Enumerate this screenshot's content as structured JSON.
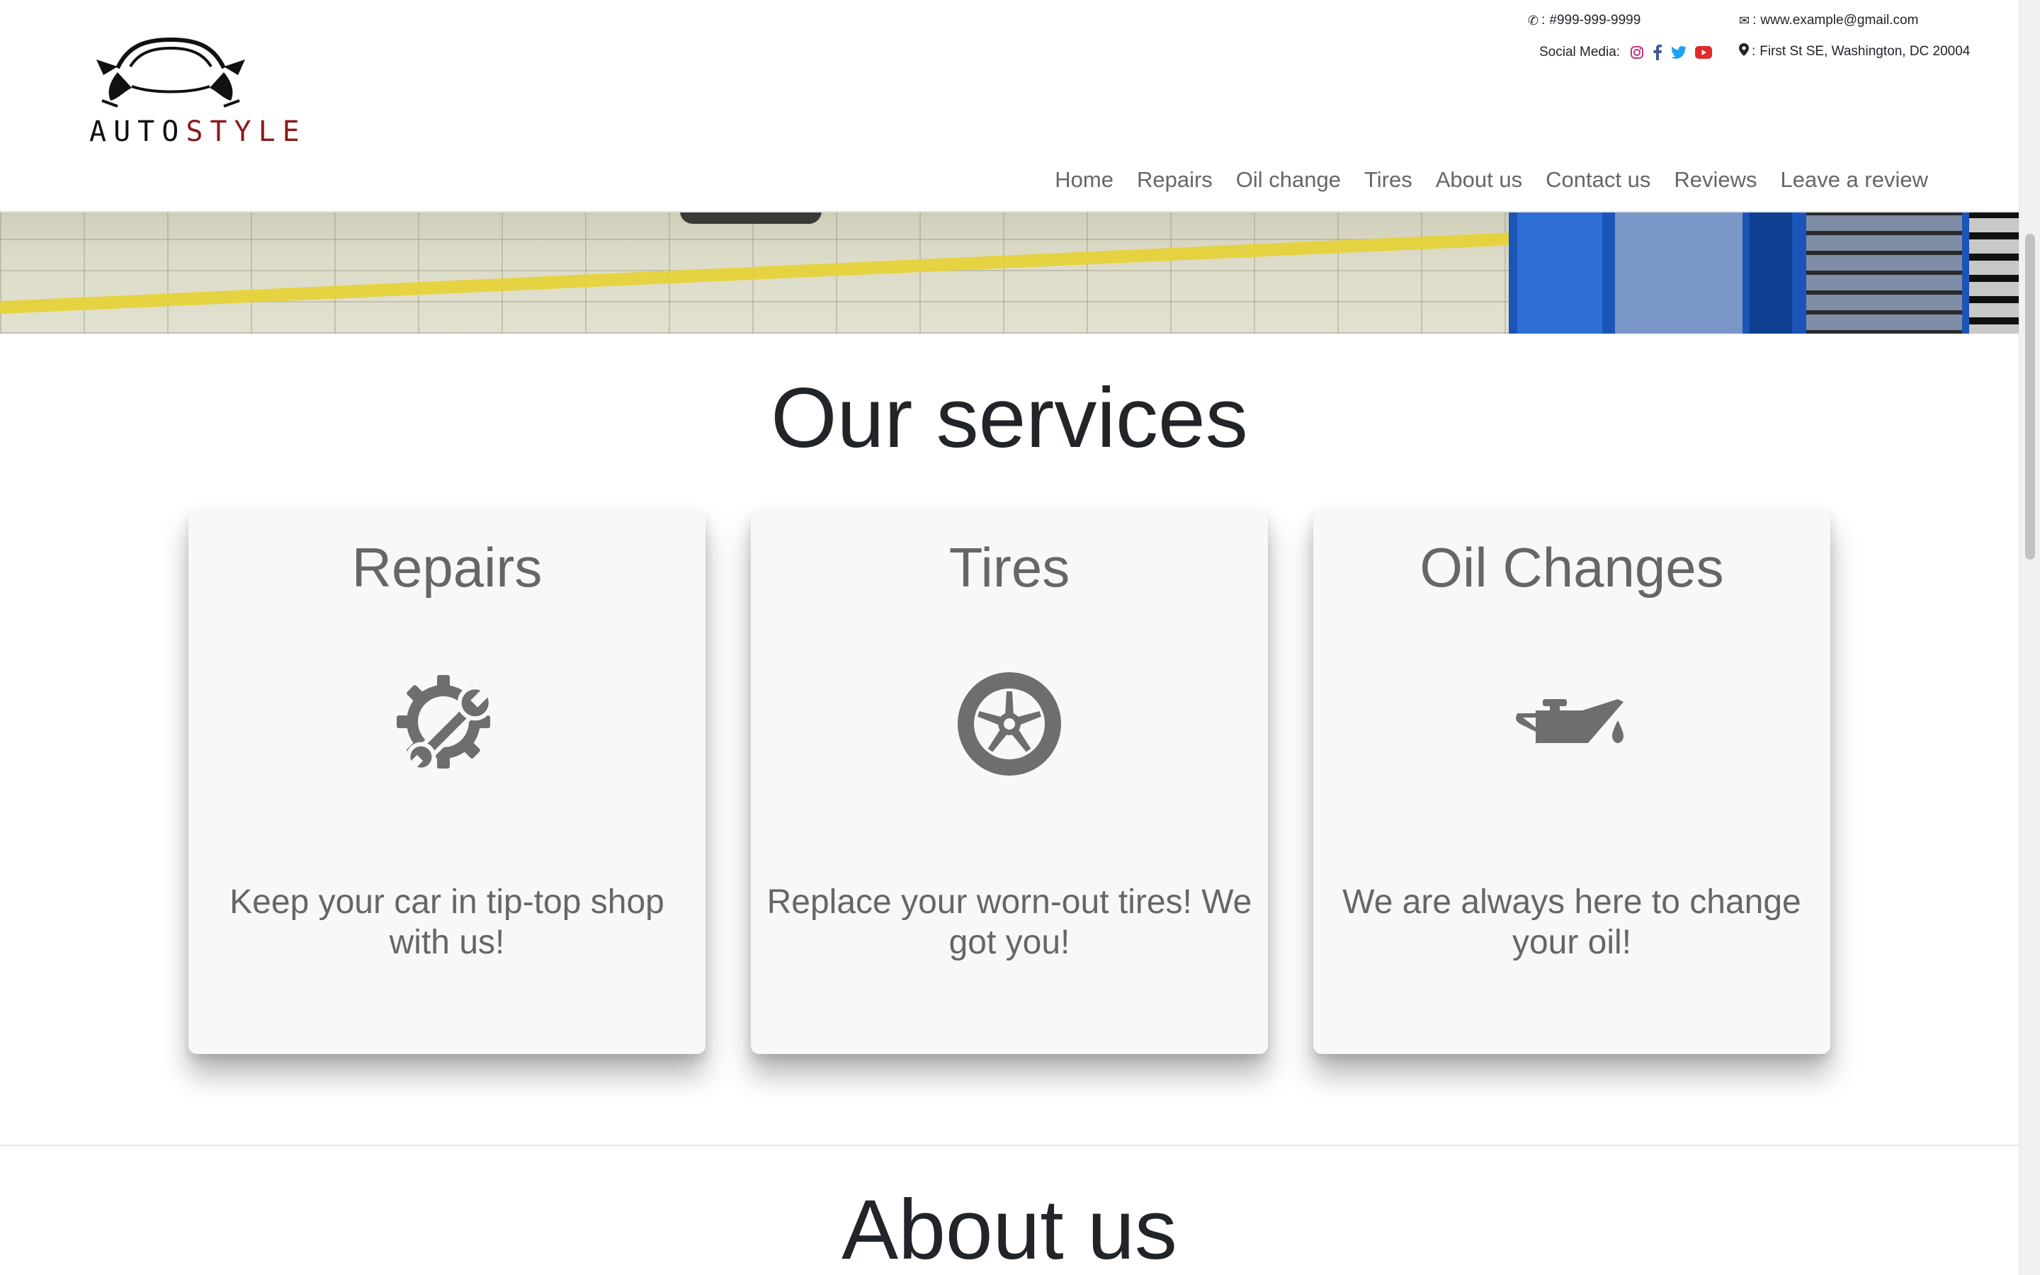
{
  "brand": {
    "logo_part1": "AUTO",
    "logo_part2": "STYLE",
    "accent_color": "#8b1a1a"
  },
  "contact": {
    "phone": "#999-999-9999",
    "email": "www.example@gmail.com",
    "address": "First St SE, Washington, DC 20004",
    "social_label": "Social Media:",
    "separator": ":",
    "social_icons": [
      "instagram-icon",
      "facebook-icon",
      "twitter-icon",
      "youtube-icon"
    ]
  },
  "nav": {
    "items": [
      "Home",
      "Repairs",
      "Oil change",
      "Tires",
      "About us",
      "Contact us",
      "Reviews",
      "Leave a review"
    ]
  },
  "services": {
    "title": "Our services",
    "cards": [
      {
        "title": "Repairs",
        "icon": "gear-wrench-icon",
        "text": "Keep your car in tip-top shop with us!"
      },
      {
        "title": "Tires",
        "icon": "tire-icon",
        "text": "Replace your worn-out tires! We got you!"
      },
      {
        "title": "Oil Changes",
        "icon": "oil-can-icon",
        "text": "We are always here to change your oil!"
      }
    ]
  },
  "about": {
    "title": "About us"
  },
  "colors": {
    "icon_gray": "#6e6e6e",
    "text_gray": "#666666",
    "card_bg": "#f7f8fa"
  }
}
